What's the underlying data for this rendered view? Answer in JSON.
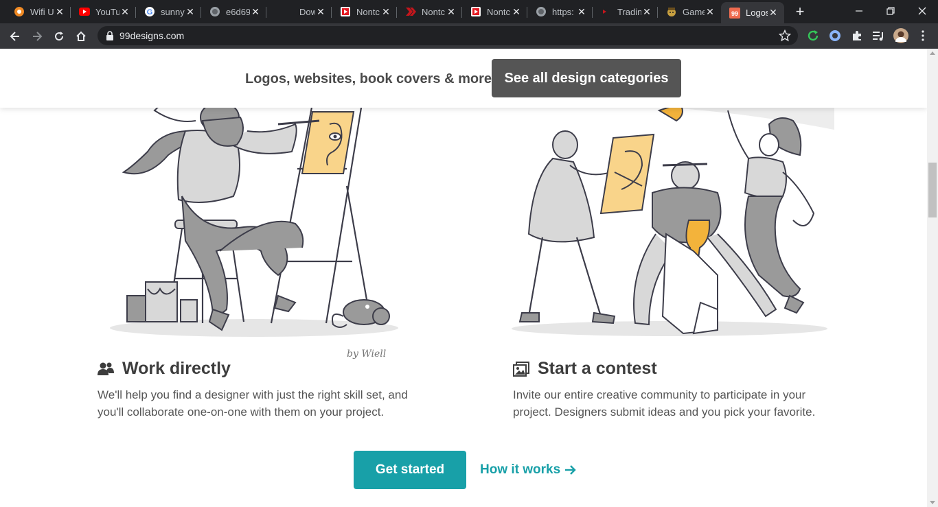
{
  "browser": {
    "tabs": [
      {
        "label": "Wifi U",
        "icon": "wifi-uncle-favicon"
      },
      {
        "label": "YouTu",
        "icon": "youtube-favicon"
      },
      {
        "label": "sunny",
        "icon": "google-favicon"
      },
      {
        "label": "e6d69",
        "icon": "globe-favicon"
      },
      {
        "label": "Down",
        "icon": "blank-favicon"
      },
      {
        "label": "Nontc",
        "icon": "video-favicon"
      },
      {
        "label": "Nontc",
        "icon": "red-chevron-favicon"
      },
      {
        "label": "Nontc",
        "icon": "video-favicon"
      },
      {
        "label": "https:",
        "icon": "globe-favicon"
      },
      {
        "label": "Tradin",
        "icon": "tradingview-favicon"
      },
      {
        "label": "Game",
        "icon": "game-favicon"
      },
      {
        "label": "Logos",
        "icon": "99designs-favicon",
        "active": true
      }
    ],
    "url": "99designs.com",
    "colors": {
      "tabstrip": "#202124",
      "toolbar": "#35363a",
      "omnibox": "#202124"
    }
  },
  "sticky_bar": {
    "tagline": "Logos, websites, book covers & more...",
    "cta_label": "See all design categories"
  },
  "illustration_credit": "by Wiell",
  "features": [
    {
      "icon": "people-icon",
      "title": "Work directly",
      "description": "We'll help you find a designer with just the right skill set, and you'll collaborate one-on-one with them on your project."
    },
    {
      "icon": "gallery-icon",
      "title": "Start a contest",
      "description": "Invite our entire creative community to participate in your project. Designers submit ideas and you pick your favorite."
    }
  ],
  "actions": {
    "primary_label": "Get started",
    "secondary_label": "How it works"
  },
  "colors": {
    "accent": "#18a0a8",
    "dark_button": "#555555",
    "illustration_yellow": "#f9d48a",
    "illustration_gray": "#9a9a9a"
  }
}
